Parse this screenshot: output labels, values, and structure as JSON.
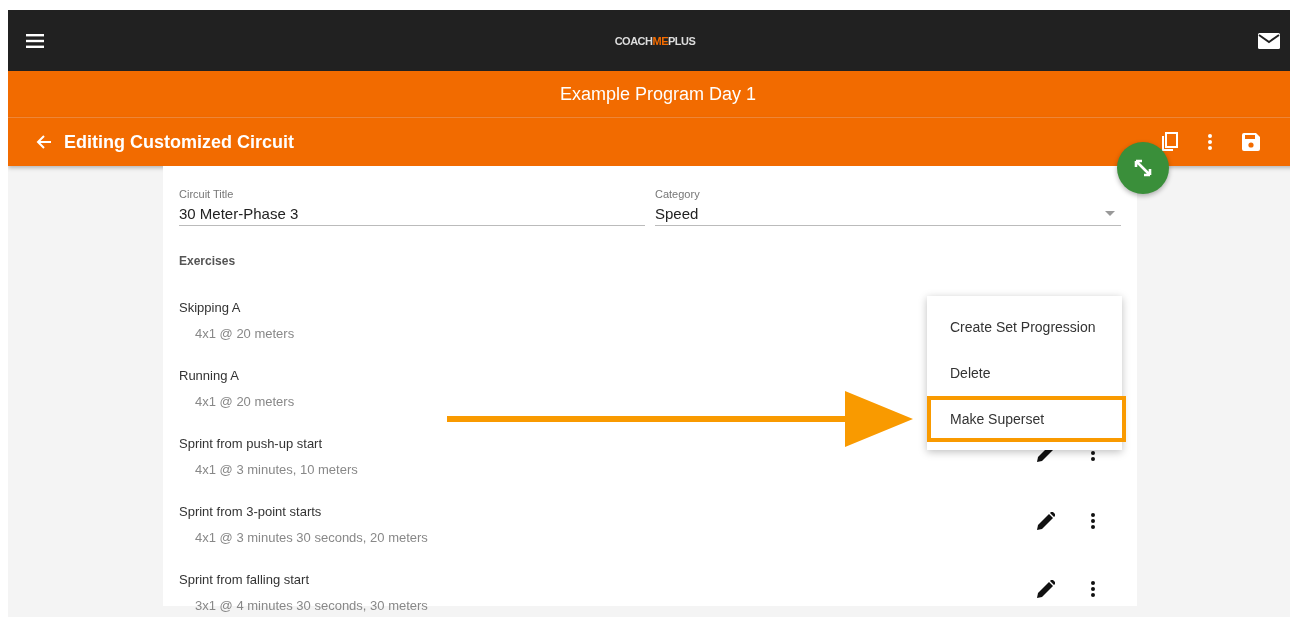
{
  "logo": [
    {
      "text": "COACH",
      "accent": false
    },
    {
      "text": "ME",
      "accent": true
    },
    {
      "text": "PLUS",
      "accent": false
    }
  ],
  "program_title": "Example Program Day 1",
  "toolbar": {
    "title": "Editing Customized Circuit"
  },
  "form": {
    "circuit_title": {
      "label": "Circuit Title",
      "value": "30 Meter-Phase 3"
    },
    "category": {
      "label": "Category",
      "value": "Speed"
    }
  },
  "exercises_heading": "Exercises",
  "exercises": [
    {
      "name": "Skipping A",
      "detail": "4x1 @ 20 meters",
      "actions_shown": false
    },
    {
      "name": "Running A",
      "detail": "4x1 @ 20 meters",
      "actions_shown": false
    },
    {
      "name": "Sprint from push-up start",
      "detail": "4x1 @ 3 minutes, 10 meters",
      "actions_shown": true
    },
    {
      "name": "Sprint from 3-point starts",
      "detail": "4x1 @ 3 minutes 30 seconds, 20 meters",
      "actions_shown": true
    },
    {
      "name": "Sprint from falling start",
      "detail": "3x1 @ 4 minutes 30 seconds, 30 meters",
      "actions_shown": true
    }
  ],
  "menu": [
    {
      "label": "Create Set Progression",
      "highlighted": false
    },
    {
      "label": "Delete",
      "highlighted": false
    },
    {
      "label": "Make Superset",
      "highlighted": true
    }
  ]
}
